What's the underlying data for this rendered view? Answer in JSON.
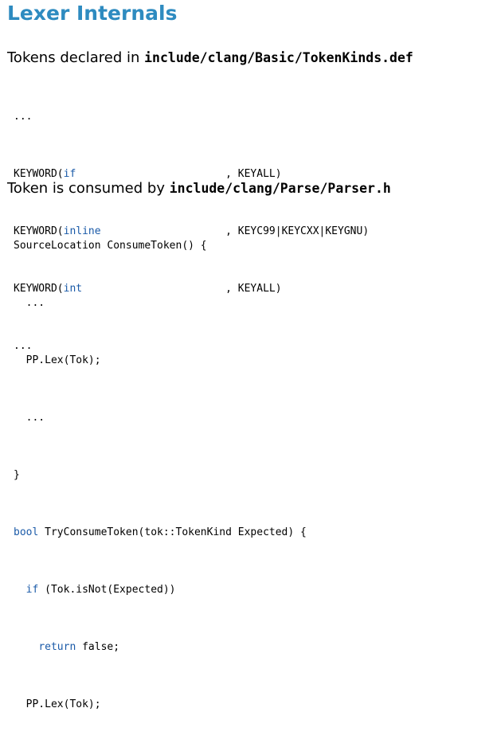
{
  "slide": {
    "title": "Lexer Internals"
  },
  "section1": {
    "text": "Tokens declared in ",
    "path": "include/clang/Basic/TokenKinds.def",
    "lines": [
      {
        "a": "...",
        "b": "",
        "c": ""
      },
      {
        "a": "KEYWORD(",
        "b": "if",
        "c": "                        , KEYALL)"
      },
      {
        "a": "KEYWORD(",
        "b": "inline",
        "c": "                    , KEYC99|KEYCXX|KEYGNU)"
      },
      {
        "a": "KEYWORD(",
        "b": "int",
        "c": "                       , KEYALL)"
      },
      {
        "a": "...",
        "b": "",
        "c": ""
      }
    ]
  },
  "section2": {
    "text": "Token is consumed by ",
    "path": "include/clang/Parse/Parser.h",
    "lines": [
      {
        "a": "SourceLocation ConsumeToken() {",
        "b": "",
        "c": ""
      },
      {
        "a": "  ...",
        "b": "",
        "c": ""
      },
      {
        "a": "  PP.Lex(Tok);",
        "b": "",
        "c": ""
      },
      {
        "a": "  ...",
        "b": "",
        "c": ""
      },
      {
        "a": "}",
        "b": "",
        "c": ""
      },
      {
        "a": "",
        "b": "bool",
        "c": " TryConsumeToken(tok::TokenKind Expected) {"
      },
      {
        "a": "  ",
        "b": "if",
        "c": " (Tok.isNot(Expected))"
      },
      {
        "a": "    ",
        "b": "return",
        "c": " false;"
      },
      {
        "a": "  PP.Lex(Tok);",
        "b": "",
        "c": ""
      },
      {
        "a": "  ...",
        "b": "",
        "c": ""
      }
    ]
  }
}
